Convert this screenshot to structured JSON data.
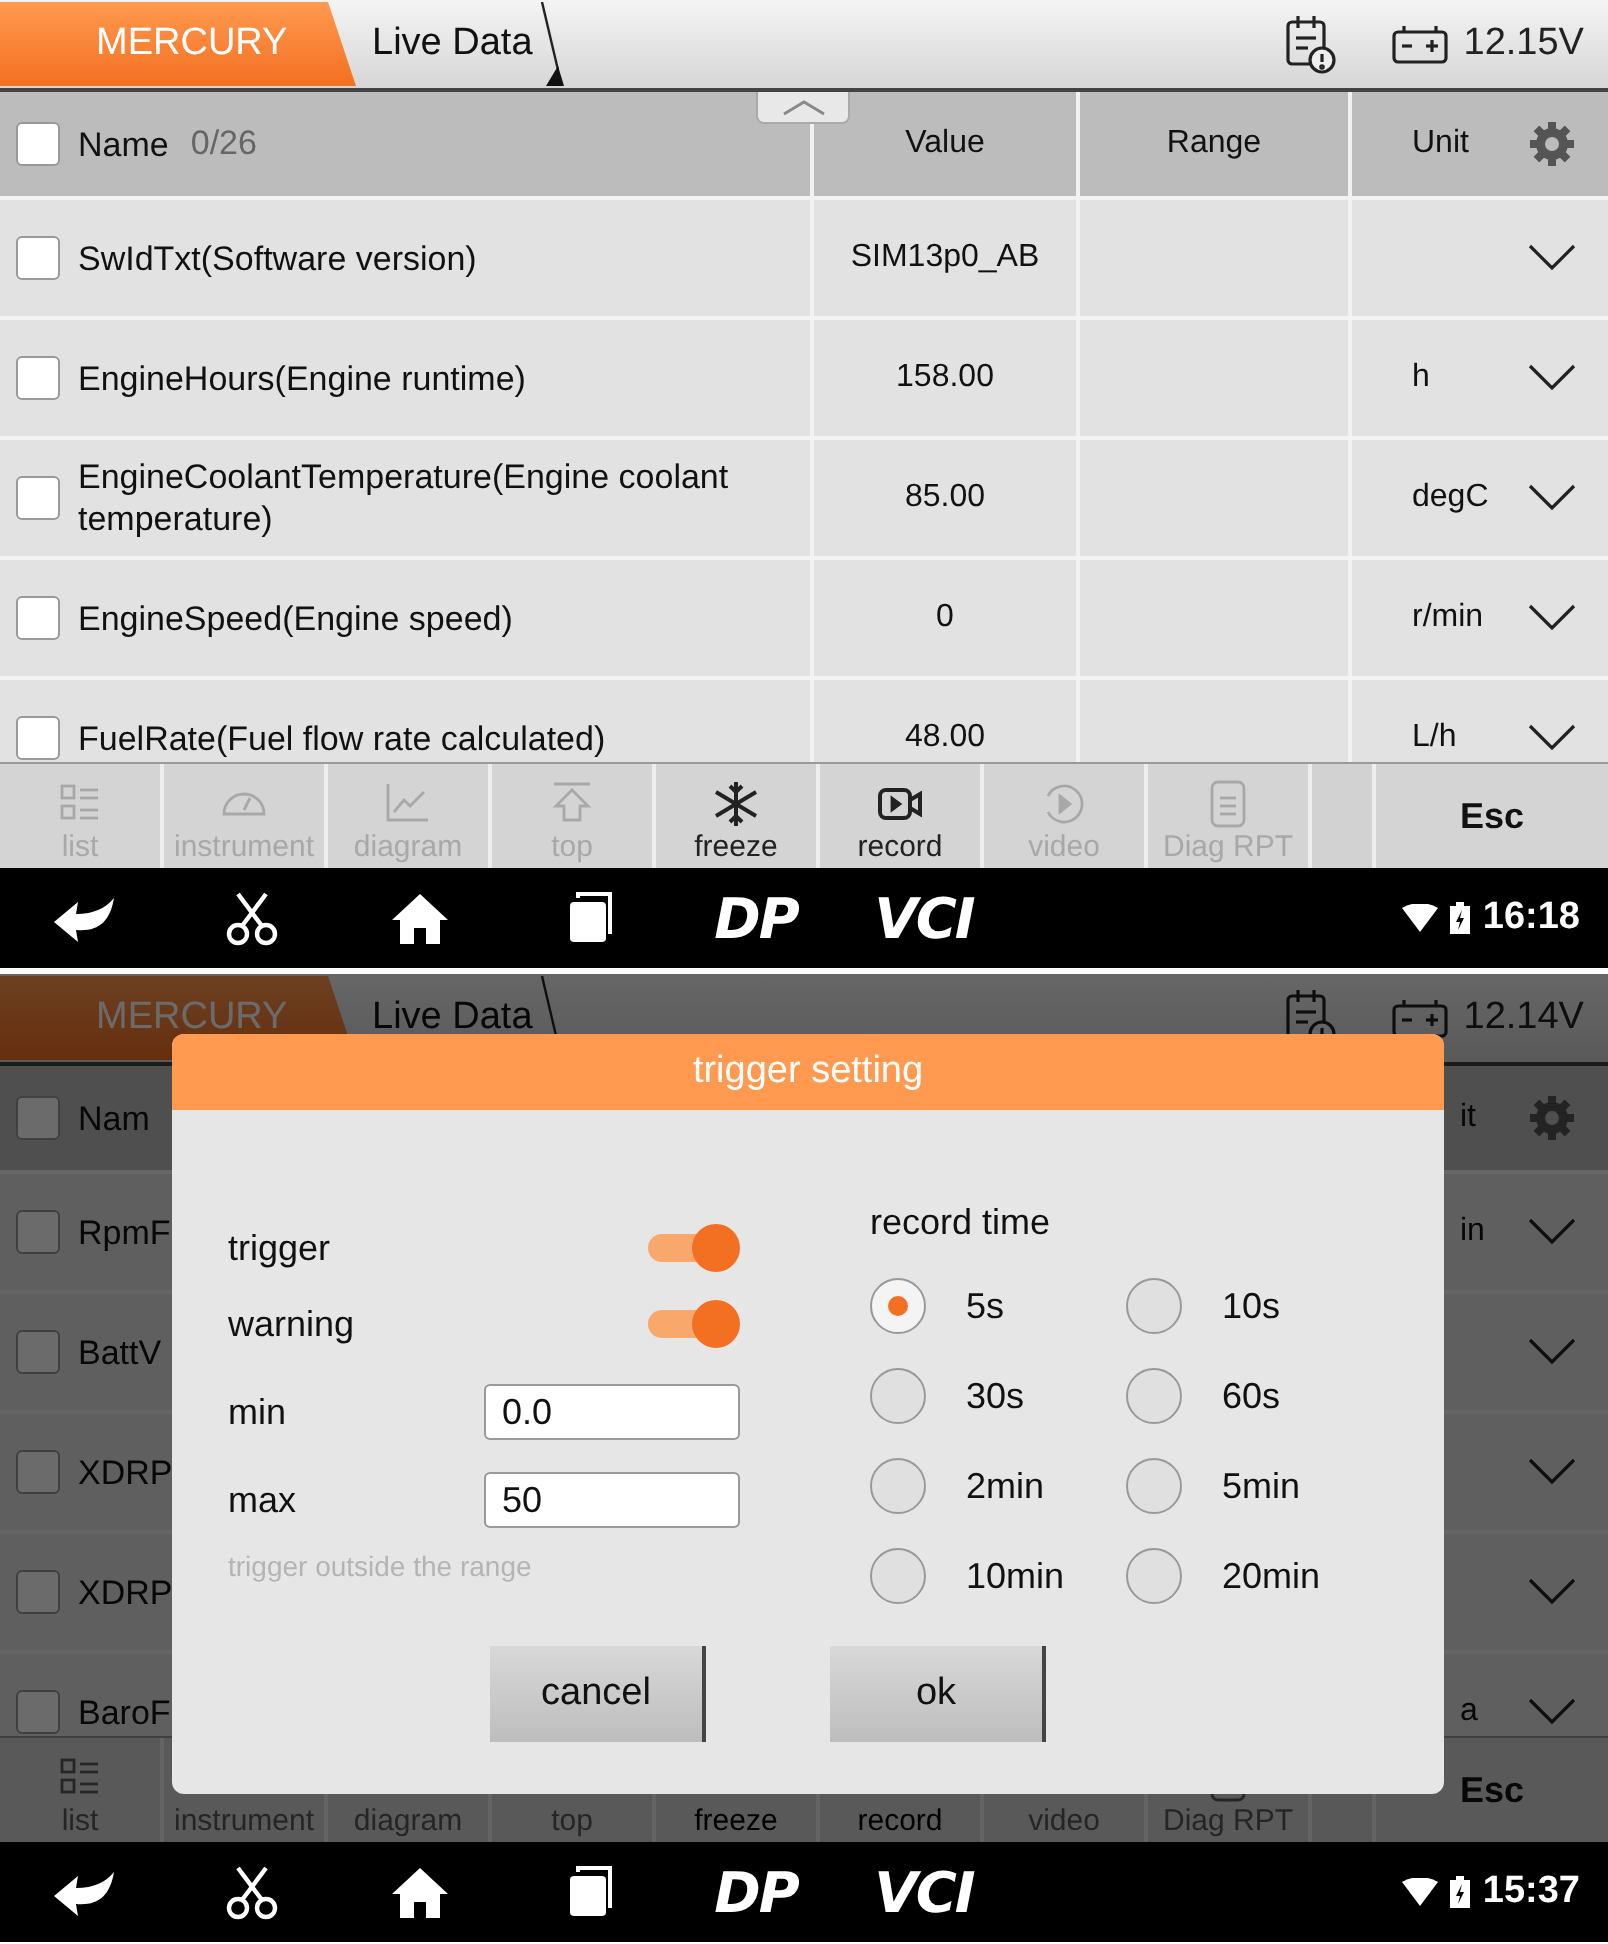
{
  "screens": [
    {
      "top_bar": {
        "brand": "MERCURY",
        "title": "Live Data",
        "voltage": "12.15V"
      },
      "table": {
        "header": {
          "checked": false,
          "name": "Name",
          "count": "0/26",
          "value": "Value",
          "range": "Range",
          "unit": "Unit"
        },
        "rows": [
          {
            "checked": false,
            "name": "SwIdTxt(Software version)",
            "value": "SIM13p0_AB"
          },
          {
            "checked": false,
            "name": "EngineHours(Engine runtime)",
            "value": "158.00",
            "unit": "h"
          },
          {
            "checked": false,
            "name": "EngineCoolantTemperature(Engine coolant temperature)",
            "value": "85.00",
            "unit": "degC"
          },
          {
            "checked": false,
            "name": "EngineSpeed(Engine speed)",
            "value": "0",
            "unit": "r/min"
          },
          {
            "checked": false,
            "name": "FuelRate(Fuel flow rate calculated)",
            "value": "48.00",
            "unit": "L/h"
          }
        ]
      },
      "toolbar": [
        {
          "label": "list",
          "disabled": true
        },
        {
          "label": "instrument",
          "disabled": true
        },
        {
          "label": "diagram",
          "disabled": true
        },
        {
          "label": "top",
          "disabled": true
        },
        {
          "label": "freeze",
          "disabled": false
        },
        {
          "label": "record",
          "disabled": false
        },
        {
          "label": "video",
          "disabled": true
        },
        {
          "label": "Diag RPT",
          "disabled": true
        }
      ],
      "esc": "Esc",
      "nav_bar": {
        "logos": [
          "DP",
          "VCI"
        ],
        "time": "16:18"
      }
    },
    {
      "top_bar": {
        "brand": "MERCURY",
        "title": "Live Data",
        "voltage": "12.14V"
      },
      "table": {
        "header": {
          "checked": false,
          "name": "Nam",
          "unit": "it"
        },
        "rows": [
          {
            "checked": false,
            "name": "RpmF",
            "unit": "in"
          },
          {
            "checked": false,
            "name": "BattV"
          },
          {
            "checked": false,
            "name": "XDRP"
          },
          {
            "checked": false,
            "name": "XDRP"
          },
          {
            "checked": false,
            "name": "BaroF",
            "unit": "a"
          }
        ]
      },
      "toolbar": [
        {
          "label": "list",
          "disabled": true
        },
        {
          "label": "instrument",
          "disabled": true
        },
        {
          "label": "diagram",
          "disabled": true
        },
        {
          "label": "top",
          "disabled": true
        },
        {
          "label": "freeze",
          "disabled": false
        },
        {
          "label": "record",
          "disabled": false
        },
        {
          "label": "video",
          "disabled": true
        },
        {
          "label": "Diag RPT",
          "disabled": true
        }
      ],
      "esc": "Esc",
      "nav_bar": {
        "logos": [
          "DP",
          "VCI"
        ],
        "time": "15:37"
      },
      "dialog": {
        "title": "trigger setting",
        "switches": [
          {
            "label": "trigger",
            "on": true
          },
          {
            "label": "warning",
            "on": true
          }
        ],
        "fields": [
          {
            "label": "min",
            "value": "0.0"
          },
          {
            "label": "max",
            "value": "50"
          }
        ],
        "hint": "trigger outside the range",
        "record_time": {
          "label": "record time",
          "options": [
            {
              "label": "5s",
              "selected": true
            },
            {
              "label": "10s",
              "selected": false
            },
            {
              "label": "30s",
              "selected": false
            },
            {
              "label": "60s",
              "selected": false
            },
            {
              "label": "2min",
              "selected": false
            },
            {
              "label": "5min",
              "selected": false
            },
            {
              "label": "10min",
              "selected": false
            },
            {
              "label": "20min",
              "selected": false
            }
          ]
        },
        "buttons": [
          "cancel",
          "ok"
        ]
      }
    }
  ]
}
